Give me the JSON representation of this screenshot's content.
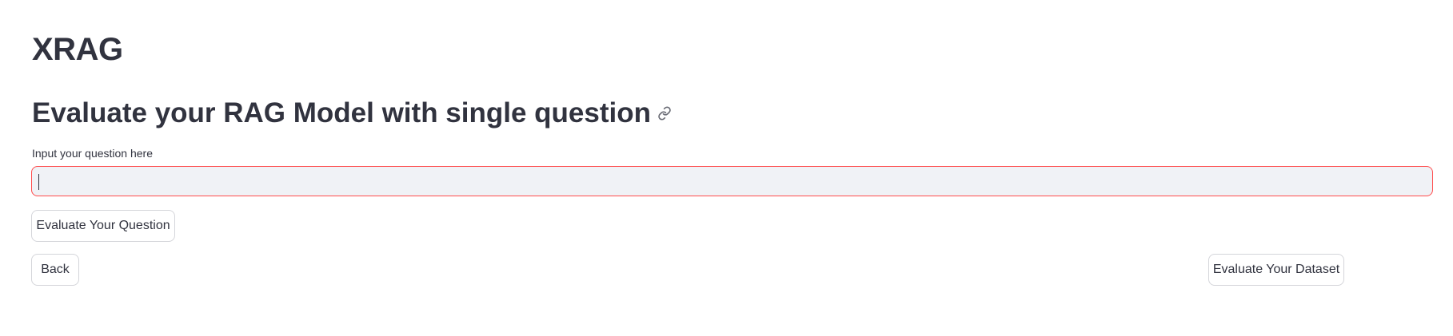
{
  "app": {
    "title": "XRAG"
  },
  "section": {
    "heading": "Evaluate your RAG Model with single question",
    "anchor_icon": "link-icon"
  },
  "question_field": {
    "label": "Input your question here",
    "value": "",
    "placeholder": "",
    "border_color": "#ff4b4b",
    "background": "#f0f2f6"
  },
  "buttons": {
    "evaluate_question": "Evaluate Your Question",
    "back": "Back",
    "evaluate_dataset": "Evaluate Your Dataset"
  },
  "colors": {
    "text": "#31333f",
    "button_border": "#d4d5da",
    "focus_border": "#ff4b4b"
  }
}
